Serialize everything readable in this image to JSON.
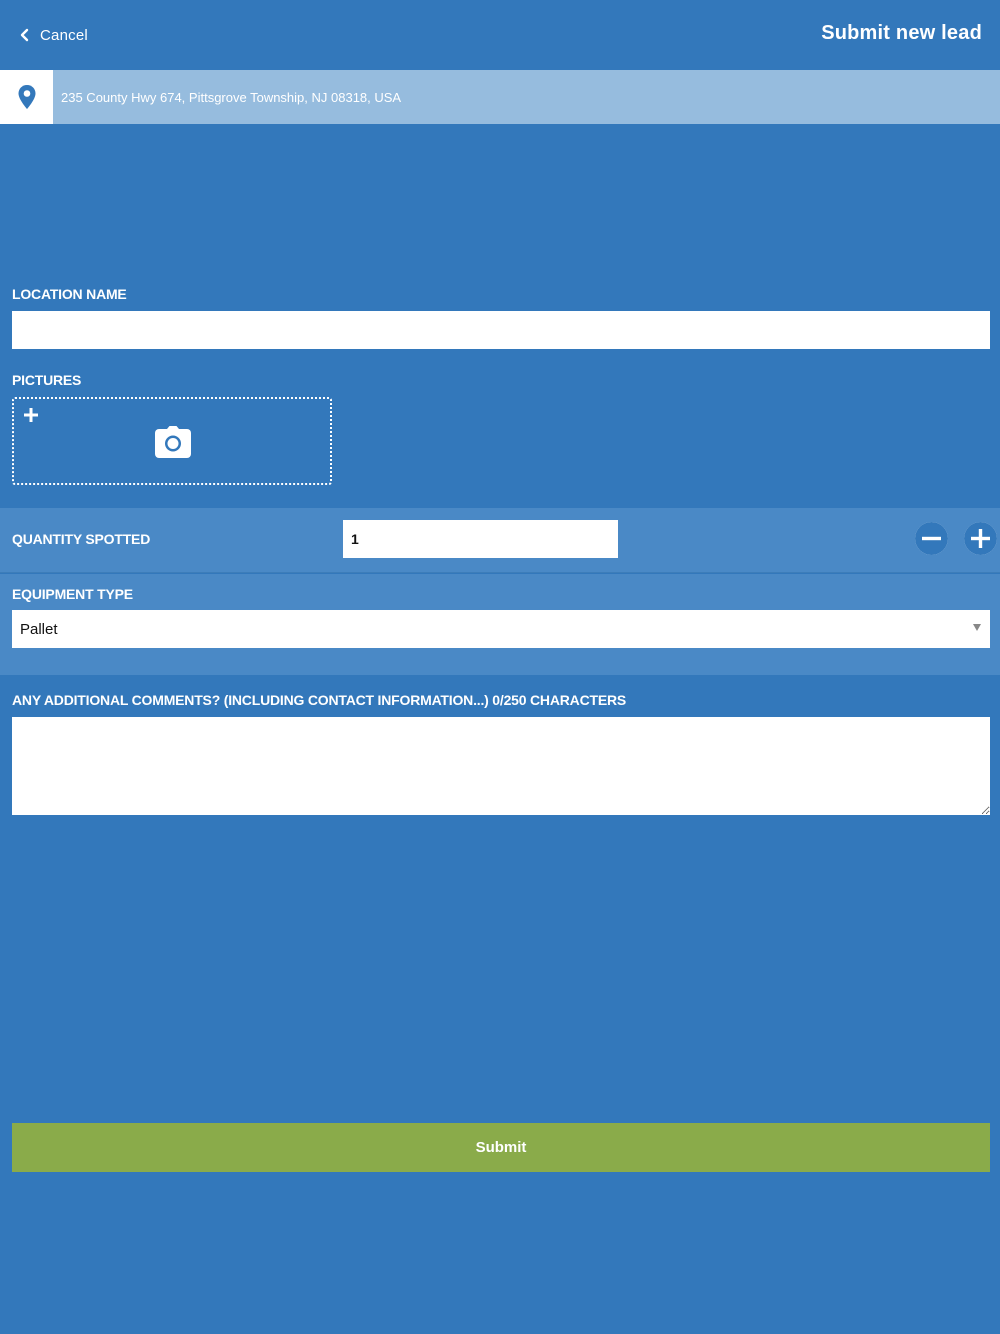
{
  "header": {
    "cancel_label": "Cancel",
    "title": "Submit new lead"
  },
  "address_bar": {
    "icon": "map-pin-icon",
    "address": "235 County Hwy 674, Pittsgrove Township, NJ 08318, USA"
  },
  "form": {
    "location_name": {
      "label": "LOCATION NAME",
      "value": ""
    },
    "pictures": {
      "label": "PICTURES",
      "add_icon": "plus-icon",
      "camera_icon": "camera-icon"
    },
    "quantity": {
      "label": "QUANTITY SPOTTED",
      "value": "1",
      "decrement_icon": "minus-icon",
      "increment_icon": "plus-icon"
    },
    "equipment_type": {
      "label": "EQUIPMENT TYPE",
      "selected": "Pallet"
    },
    "comments": {
      "label": "ANY ADDITIONAL COMMENTS? (INCLUDING CONTACT INFORMATION...) 0/250 CHARACTERS",
      "value": ""
    },
    "submit_label": "Submit"
  },
  "colors": {
    "background": "#3378bb",
    "band": "#4a89c6",
    "address_bar": "#96bcde",
    "submit": "#8aab4a"
  }
}
